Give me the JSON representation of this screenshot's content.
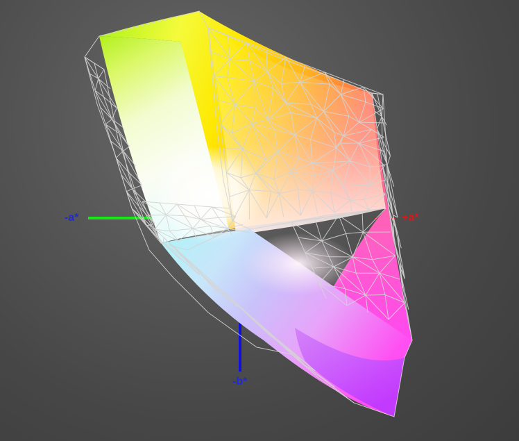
{
  "axes": {
    "neg_a": {
      "label": "-a*",
      "color": "#1f2bd6",
      "line_color": "#19e619"
    },
    "pos_a": {
      "label": "+a*",
      "color": "#e01616",
      "line_color": "#e01616"
    },
    "neg_b": {
      "label": "-b*",
      "color": "#1f2bd6",
      "line_color": "#1010d8"
    }
  },
  "colors": {
    "background": "#4b4b4b",
    "wireframe": "#d4d4d4"
  }
}
